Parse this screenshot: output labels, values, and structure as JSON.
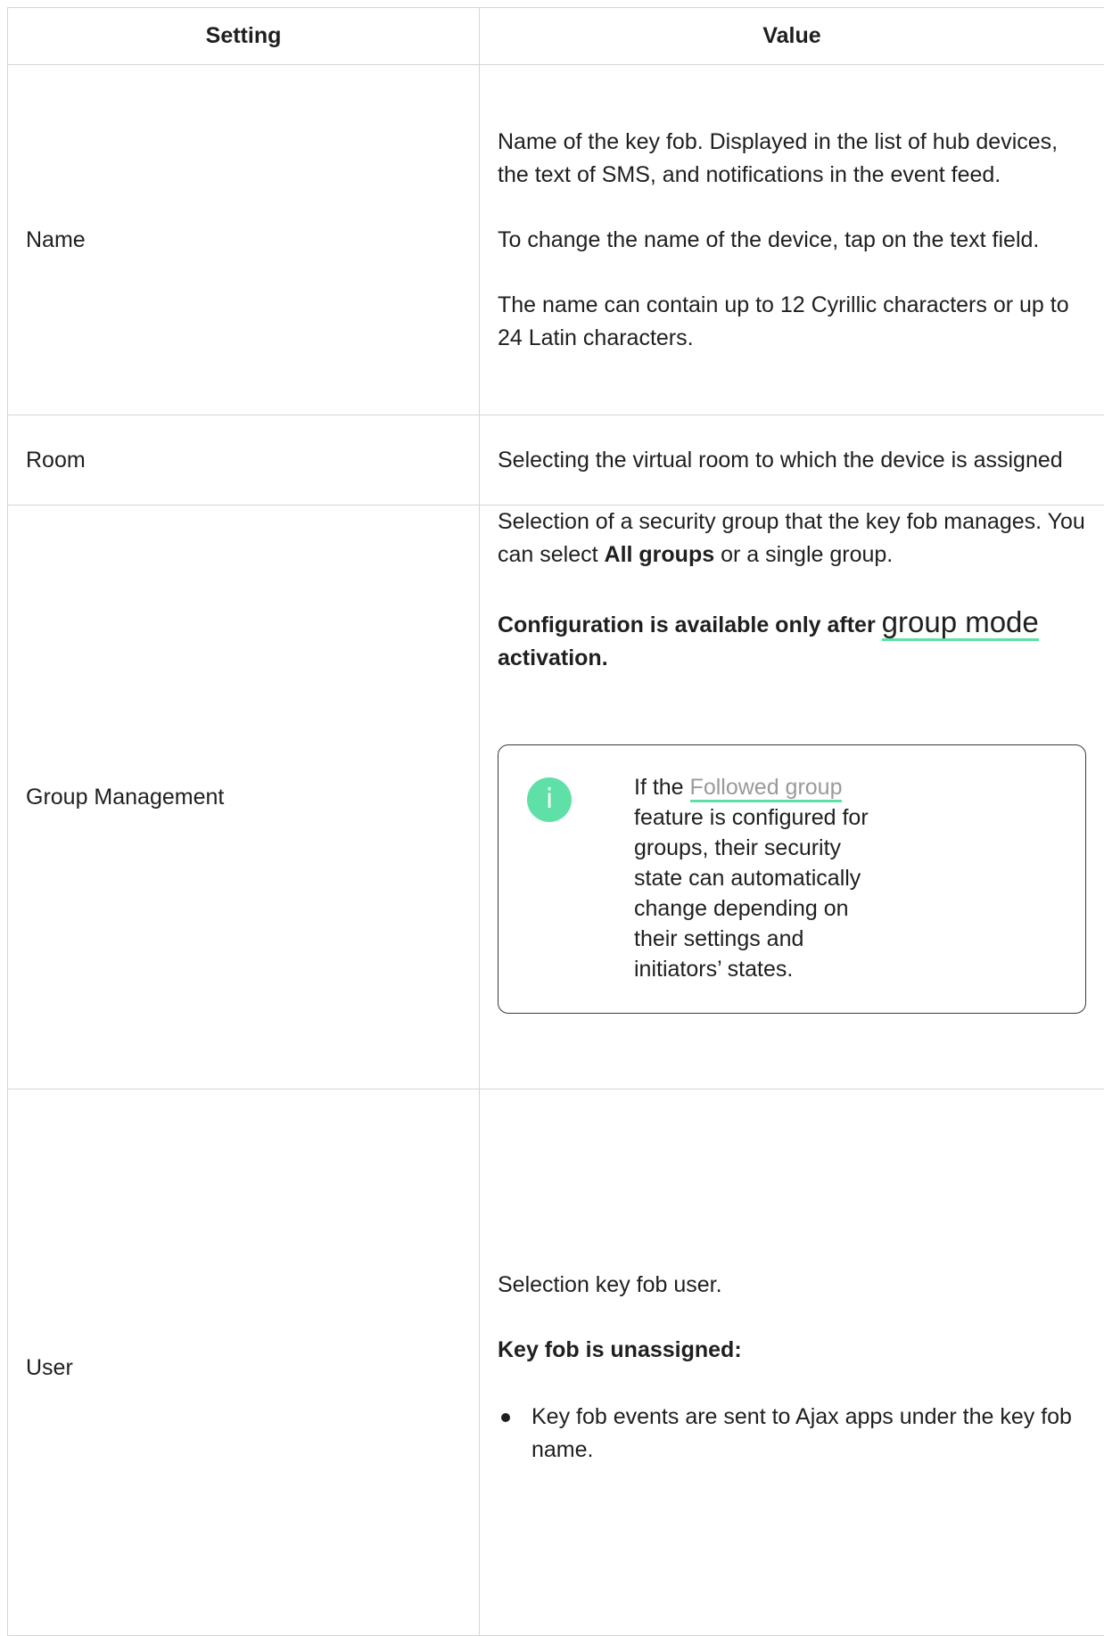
{
  "table": {
    "headers": {
      "setting": "Setting",
      "value": "Value"
    },
    "rows": {
      "name": {
        "setting": "Name",
        "value_p1": "Name of the key fob. Displayed in the list of hub devices, the text of SMS, and notifications in the event feed.",
        "value_p2": "To change the name of the device, tap on the text field.",
        "value_p3": "The name can contain up to 12 Cyrillic characters or up to 24 Latin characters."
      },
      "room": {
        "setting": "Room",
        "value": "Selecting the virtual room to which the device is assigned"
      },
      "group": {
        "setting": "Group Management",
        "value_p1_before": "Selection of a security group that the key fob manages. You can select ",
        "value_p1_bold": "All groups",
        "value_p1_after": " or a single group.",
        "note_before": "Configuration is available only after ",
        "note_link": "group mode",
        "note_after": " activation.",
        "callout": {
          "icon": "info-icon",
          "icon_glyph": "i",
          "text_before": "If the ",
          "link": "Followed group",
          "text_after": " feature is configured for groups, their security state can automatically change depending on their settings and initiators’ states."
        }
      },
      "user": {
        "setting": "User",
        "value_p1": "Selection key fob user.",
        "value_heading": "Key fob is unassigned:",
        "bullets": [
          "Key fob events are sent to Ajax apps under the key fob name."
        ]
      }
    }
  },
  "colors": {
    "accent": "#5fe0a6",
    "border": "#d6d6d6",
    "link_muted": "#9a9a9a",
    "text": "#1f1f1f"
  }
}
